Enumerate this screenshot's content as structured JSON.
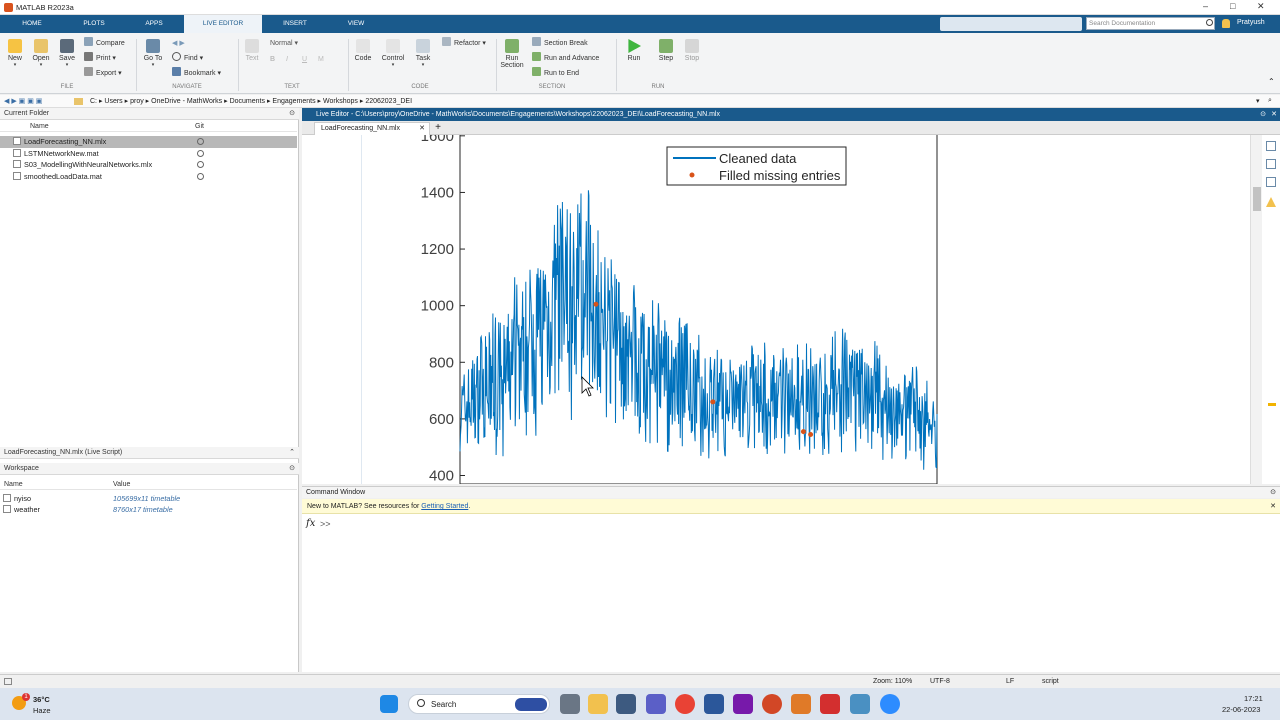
{
  "window": {
    "title": "MATLAB R2023a"
  },
  "tabs": [
    {
      "label": "HOME"
    },
    {
      "label": "PLOTS"
    },
    {
      "label": "APPS"
    },
    {
      "label": "LIVE EDITOR"
    },
    {
      "label": "INSERT"
    },
    {
      "label": "VIEW"
    }
  ],
  "search": {
    "placeholder": "Search Documentation"
  },
  "user": {
    "name": "Pratyush"
  },
  "ribbon": {
    "file": {
      "new": "New",
      "open": "Open",
      "save": "Save",
      "compare": "Compare",
      "print": "Print",
      "export": "Export",
      "group": "FILE"
    },
    "navigate": {
      "goto": "Go To",
      "find": "Find",
      "bookmark": "Bookmark",
      "group": "NAVIGATE"
    },
    "text": {
      "style": "Normal",
      "text_label": "Text",
      "bold": "B",
      "italic": "I",
      "underline": "U",
      "mono": "M",
      "group": "TEXT"
    },
    "code": {
      "code": "Code",
      "control": "Control",
      "task": "Task",
      "refactor": "Refactor",
      "group": "CODE"
    },
    "section": {
      "run_section": "Run Section",
      "section_break": "Section Break",
      "run_advance": "Run and Advance",
      "run_end": "Run to End",
      "group": "SECTION"
    },
    "run": {
      "run": "Run",
      "step": "Step",
      "stop": "Stop",
      "group": "RUN"
    }
  },
  "address": {
    "parts": [
      "C:",
      "Users",
      "proy",
      "OneDrive - MathWorks",
      "Documents",
      "Engagements",
      "Workshops",
      "22062023_DEI"
    ]
  },
  "current_folder": {
    "title": "Current Folder",
    "col_name": "Name",
    "col_git": "Git",
    "files": [
      {
        "name": "LoadForecasting_NN.mlx",
        "selected": true
      },
      {
        "name": "LSTMNetworkNew.mat",
        "selected": false
      },
      {
        "name": "S03_ModellingWithNeuralNetworks.mlx",
        "selected": false
      },
      {
        "name": "smoothedLoadData.mat",
        "selected": false
      }
    ]
  },
  "details": {
    "text": "LoadForecasting_NN.mlx  (Live Script)"
  },
  "workspace": {
    "title": "Workspace",
    "col_name": "Name",
    "col_value": "Value",
    "vars": [
      {
        "name": "nyiso",
        "value": "105699x11 timetable"
      },
      {
        "name": "weather",
        "value": "8760x17 timetable"
      }
    ]
  },
  "editor": {
    "header": "Live Editor - C:\\Users\\proy\\OneDrive - MathWorks\\Documents\\Engagements\\Workshops\\22062023_DEI\\LoadForecasting_NN.mlx",
    "tab": "LoadForecasting_NN.mlx",
    "add_tab": "+"
  },
  "chart_data": {
    "type": "line",
    "yticks": [
      400,
      600,
      800,
      1000,
      1200,
      1400,
      1600
    ],
    "ylim": [
      370,
      1610
    ],
    "xlabel": "",
    "ylabel": "",
    "grid": false,
    "legend_position": "top-right",
    "series": [
      {
        "name": "Cleaned data",
        "color": "#0072BD",
        "envelope": [
          {
            "x": 0.0,
            "lo": 440,
            "hi": 800
          },
          {
            "x": 0.05,
            "lo": 460,
            "hi": 950
          },
          {
            "x": 0.1,
            "lo": 470,
            "hi": 1050
          },
          {
            "x": 0.15,
            "lo": 520,
            "hi": 1250
          },
          {
            "x": 0.2,
            "lo": 560,
            "hi": 1420
          },
          {
            "x": 0.25,
            "lo": 600,
            "hi": 1400
          },
          {
            "x": 0.28,
            "lo": 620,
            "hi": 1450
          },
          {
            "x": 0.3,
            "lo": 580,
            "hi": 1200
          },
          {
            "x": 0.35,
            "lo": 540,
            "hi": 1100
          },
          {
            "x": 0.4,
            "lo": 500,
            "hi": 1050
          },
          {
            "x": 0.45,
            "lo": 470,
            "hi": 1000
          },
          {
            "x": 0.5,
            "lo": 460,
            "hi": 900
          },
          {
            "x": 0.55,
            "lo": 450,
            "hi": 870
          },
          {
            "x": 0.6,
            "lo": 460,
            "hi": 880
          },
          {
            "x": 0.65,
            "lo": 470,
            "hi": 900
          },
          {
            "x": 0.7,
            "lo": 470,
            "hi": 880
          },
          {
            "x": 0.75,
            "lo": 460,
            "hi": 860
          },
          {
            "x": 0.8,
            "lo": 470,
            "hi": 950
          },
          {
            "x": 0.85,
            "lo": 460,
            "hi": 900
          },
          {
            "x": 0.9,
            "lo": 450,
            "hi": 840
          },
          {
            "x": 0.95,
            "lo": 440,
            "hi": 800
          },
          {
            "x": 1.0,
            "lo": 380,
            "hi": 720
          }
        ]
      },
      {
        "name": "Filled missing entries",
        "color": "#D95319",
        "points": [
          {
            "x": 0.285,
            "y": 1005
          },
          {
            "x": 0.53,
            "y": 660
          },
          {
            "x": 0.72,
            "y": 555
          },
          {
            "x": 0.735,
            "y": 545
          }
        ]
      }
    ]
  },
  "command_window": {
    "title": "Command Window",
    "welcome_prefix": "New to MATLAB? See resources for ",
    "welcome_link": "Getting Started",
    "welcome_suffix": ".",
    "fx": "fx",
    "prompt": ">>"
  },
  "status": {
    "zoom": "Zoom: 110%",
    "encoding": "UTF-8",
    "eol": "LF",
    "type": "script"
  },
  "taskbar": {
    "temp": "36°C",
    "weather": "Haze",
    "search": "Search",
    "time": "17:21",
    "date": "22-06-2023",
    "badge": "1"
  }
}
